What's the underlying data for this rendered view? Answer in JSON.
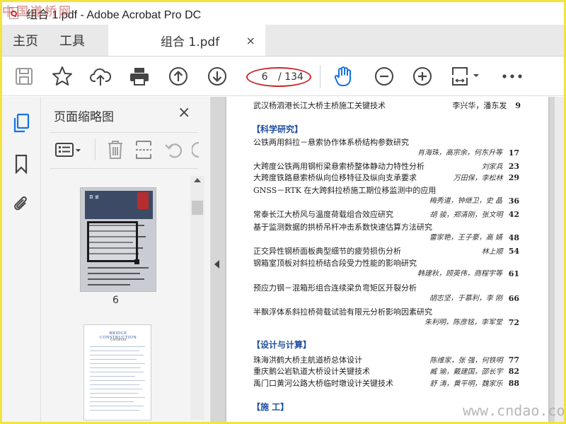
{
  "window": {
    "title": "组合 1.pdf - Adobe Acrobat Pro DC",
    "watermark_top": "中国道桥网"
  },
  "tabs": {
    "home": "主页",
    "tools": "工具",
    "document": "组合 1.pdf",
    "close_glyph": "×"
  },
  "toolbar": {
    "page_current": "6",
    "page_total": "/ 134",
    "highlight_color": "#c9262b",
    "icons": [
      "save-icon",
      "star-icon",
      "cloud-upload-icon",
      "print-icon",
      "page-up-icon",
      "page-down-icon",
      "hand-tool-icon",
      "zoom-out-icon",
      "zoom-in-icon",
      "page-fit-icon",
      "more-icon"
    ]
  },
  "panel": {
    "title": "页面缩略图",
    "close_glyph": "×",
    "thumbnail_page_label": "6",
    "thumb1_heading": "目 录",
    "thumb2_title": "BRIDGE CONSTRUCTION",
    "thumb2_sub": "Contents"
  },
  "document": {
    "top_entry": {
      "title": "武汉杨泗港长江大桥主桥施工关键技术",
      "authors": "李兴华，潘东发",
      "page": "9"
    },
    "sections": [
      {
        "heading": "【科学研究】",
        "entries": [
          {
            "title": "公铁两用斜拉－悬索协作体系桥结构参数研究",
            "authors": "肖海珠，高宗余，何东升等",
            "page": "17"
          },
          {
            "title": "大跨度公铁两用钢桁梁悬索桥整体静动力特性分析",
            "authors": "刘家兵",
            "page": "23"
          },
          {
            "title": "大跨度铁路悬索桥纵向位移特征及纵向支承要求",
            "authors": "万田保，李松林",
            "page": "29"
          },
          {
            "title": "GNSS－RTK 在大跨斜拉桥施工期位移监测中的应用",
            "authors": "梅秀道，钟继卫，史 晶",
            "page": "36"
          },
          {
            "title": "常泰长江大桥风与温度荷载组合效应研究",
            "authors": "胡 骏，郑清刚，张文明",
            "page": "42"
          },
          {
            "title": "基于监测数据的拱桥吊杆冲击系数快速估算方法研究",
            "authors": "雷家艳，王子豪，高 婧",
            "page": "48"
          },
          {
            "title": "正交异性钢桥面板典型细节的疲劳损伤分析",
            "authors": "林上顺",
            "page": "54"
          },
          {
            "title": "钢箱室顶板对斜拉桥结合段受力性能的影响研究",
            "authors": "韩建秋，顾英伟，商程宇等",
            "page": "61"
          },
          {
            "title": "预应力钢－混箱形组合连续梁负弯矩区开裂分析",
            "authors": "胡志坚，于慕利，李 刚",
            "page": "66"
          },
          {
            "title": "半飘浮体系斜拉桥荷载试验有限元分析影响因素研究",
            "authors": "朱利明，陈彦铭，李军堂",
            "page": "72"
          }
        ]
      },
      {
        "heading": "【设计与计算】",
        "entries": [
          {
            "title": "珠海洪鹤大桥主航道桥总体设计",
            "authors": "陈维家，张 强，何铁明",
            "page": "77"
          },
          {
            "title": "重庆鹅公岩轨道大桥设计关键技术",
            "authors": "臧 瑜，戴建国，邵长宇",
            "page": "82"
          },
          {
            "title": "禹门口黄河公路大桥临时墩设计关键技术",
            "authors": "舒 涛，黄平明，魏家乐",
            "page": "88"
          }
        ]
      },
      {
        "heading": "【施 工】",
        "entries": []
      }
    ]
  },
  "watermark_bottom": "www.cndao.com"
}
